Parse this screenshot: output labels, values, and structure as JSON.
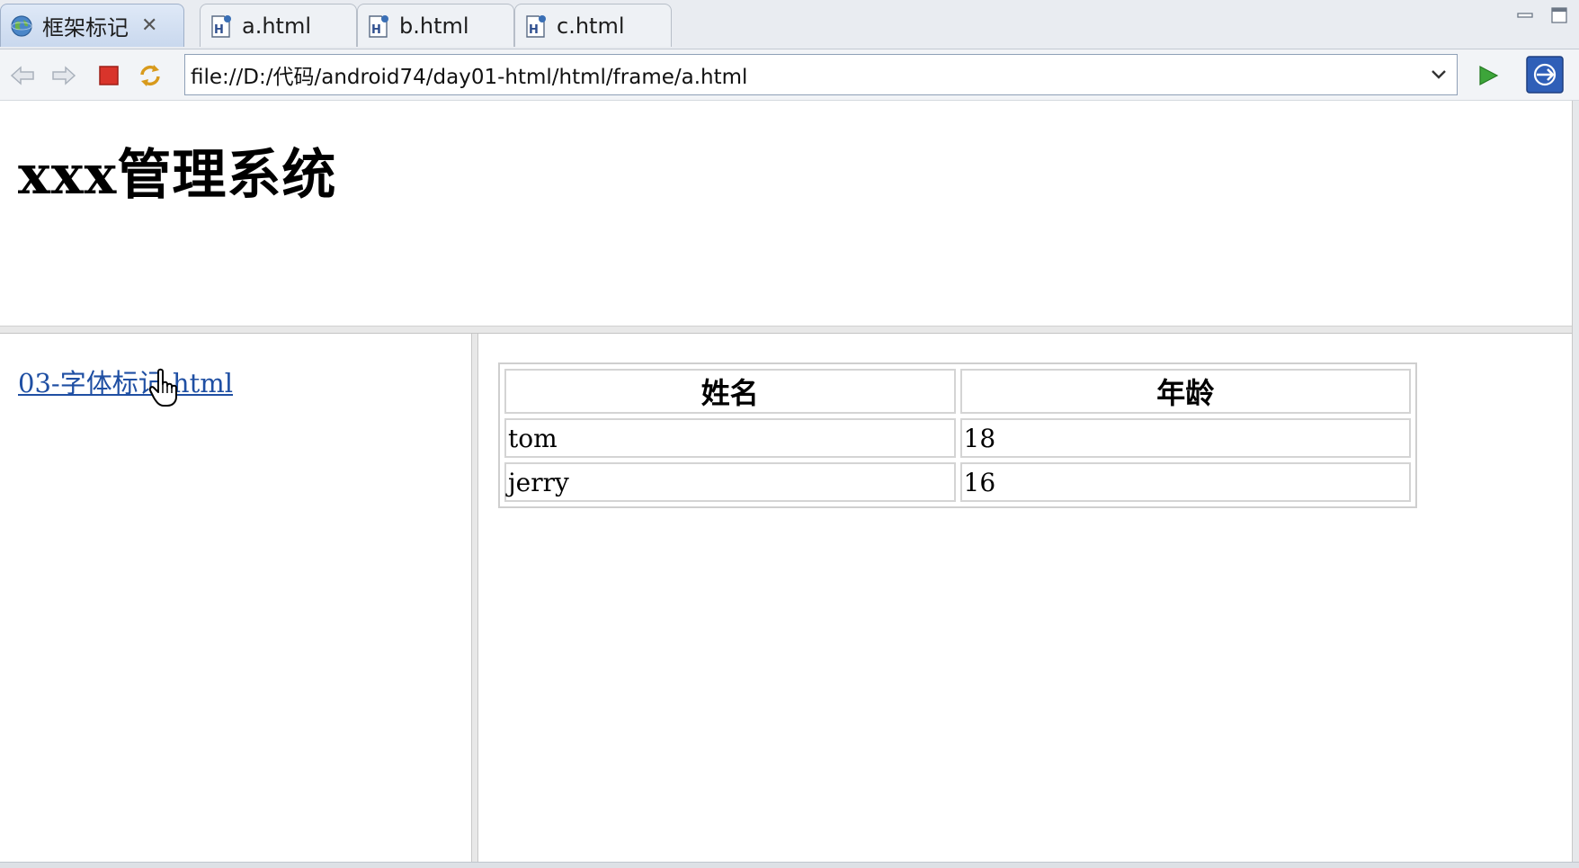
{
  "tabs": [
    {
      "label": "框架标记",
      "icon": "globe-icon",
      "active": true,
      "closable": true
    },
    {
      "label": "a.html",
      "icon": "html-file-icon",
      "active": false
    },
    {
      "label": "b.html",
      "icon": "html-file-icon",
      "active": false
    },
    {
      "label": "c.html",
      "icon": "html-file-icon",
      "active": false
    }
  ],
  "toolbar": {
    "url": "file://D:/代码/android74/day01-html/html/frame/a.html",
    "icons": [
      "back-arrow-icon",
      "forward-arrow-icon",
      "stop-icon",
      "refresh-icon",
      "go-icon",
      "open-external-icon"
    ]
  },
  "top_frame": {
    "title": "xxx管理系统"
  },
  "left_frame": {
    "link_text": "03-字体标记.html"
  },
  "right_frame": {
    "table": {
      "headers": [
        "姓名",
        "年龄"
      ],
      "rows": [
        [
          "tom",
          "18"
        ],
        [
          "jerry",
          "16"
        ]
      ]
    }
  },
  "colors": {
    "link": "#1f4fa3",
    "stop": "#d9342b",
    "go": "#3da53a",
    "active_tab": "#c9d8ee"
  }
}
